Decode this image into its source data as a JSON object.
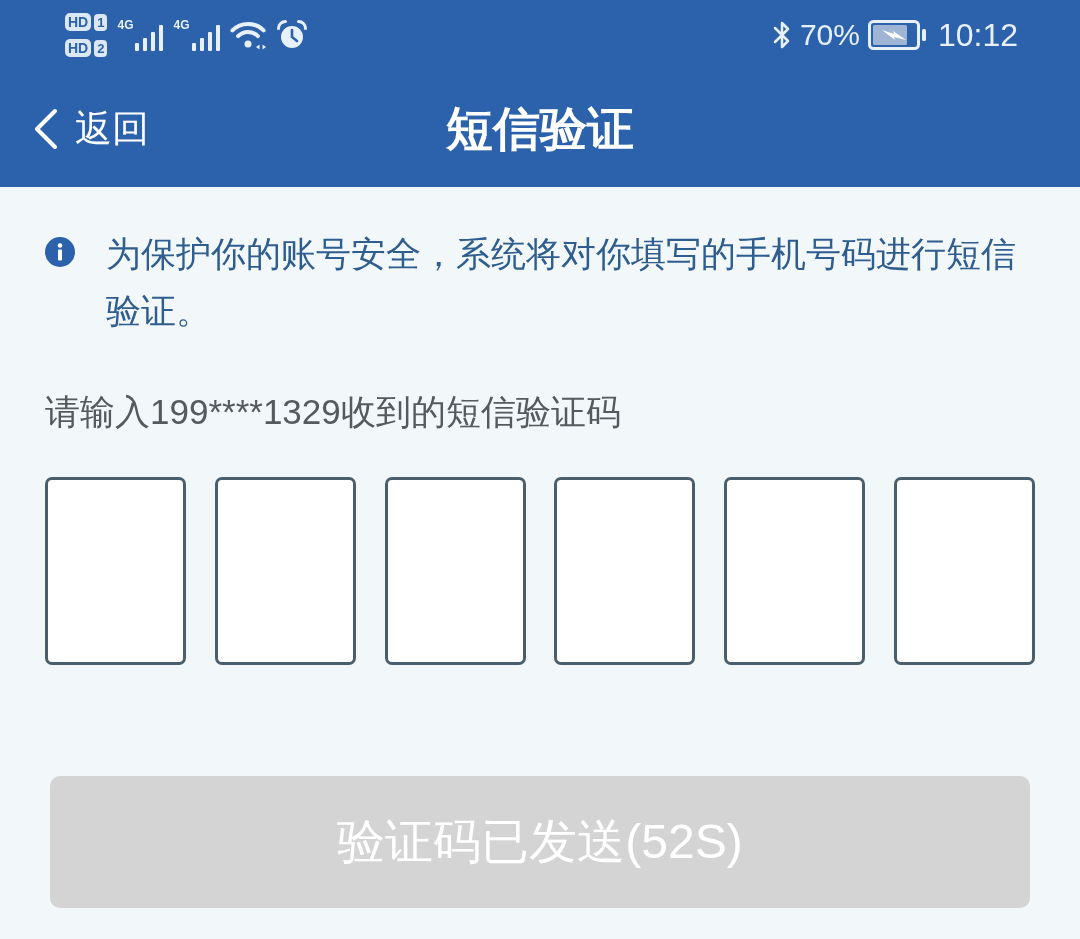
{
  "status_bar": {
    "sims": [
      {
        "label": "HD",
        "slot": "1"
      },
      {
        "label": "HD",
        "slot": "2"
      }
    ],
    "signals": [
      {
        "network": "4G"
      },
      {
        "network": "4G"
      }
    ],
    "battery_percent": "70%",
    "time": "10:12"
  },
  "nav_bar": {
    "back": "返回",
    "title": "短信验证"
  },
  "notice": {
    "text": "为保护你的账号安全，系统将对你填写的手机号码进行短信验证。"
  },
  "code_prompt": "请输入199****1329收到的短信验证码",
  "code_boxes": [
    {
      "focused": false
    },
    {
      "focused": false
    },
    {
      "focused": false
    },
    {
      "focused": false
    },
    {
      "focused": false
    },
    {
      "focused": false
    }
  ],
  "submit_button": {
    "label": "验证码已发送(52S)",
    "disabled": true
  }
}
